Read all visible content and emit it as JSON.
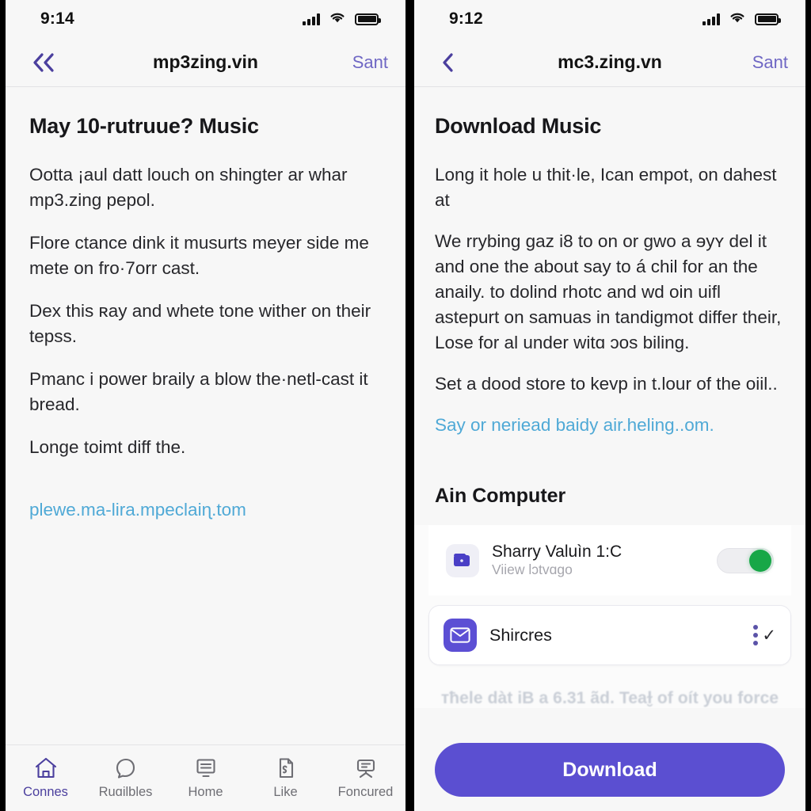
{
  "left": {
    "status": {
      "time": "9:14",
      "signal_icon": "cellular-signal-icon",
      "wifi_icon": "wifi-icon",
      "battery_icon": "battery-full-icon"
    },
    "nav": {
      "back_icon": "double-chevron-left-icon",
      "title": "mp3ᴢing.vin",
      "action": "Sant"
    },
    "heading": "May 10-rutruue? Music",
    "paragraphs": [
      "Ootta ¡aul datt louch on shingter ar whar mp3.zing pepol.",
      "Flore ctance dink it musurts meyer side me mete on fro·7orr cast.",
      "Dex this ʀay and whete tone wither on their tepss.",
      "Pmanc i power braily a blow the·netl-cast it bread.",
      "Longe toimt diff the."
    ],
    "link": "plewe.ma-lira.mpeclaiɳ.tom",
    "tabs": [
      {
        "label": "Connes",
        "icon": "home-icon",
        "active": true
      },
      {
        "label": "Ruɑilbles",
        "icon": "chat-bubble-icon",
        "active": false
      },
      {
        "label": "Home",
        "icon": "monitor-icon",
        "active": false
      },
      {
        "label": "Like",
        "icon": "document-icon",
        "active": false
      },
      {
        "label": "Foncured",
        "icon": "presentation-icon",
        "active": false
      }
    ]
  },
  "right": {
    "status": {
      "time": "9:12",
      "signal_icon": "cellular-signal-icon",
      "wifi_icon": "wifi-icon",
      "battery_icon": "battery-full-icon"
    },
    "nav": {
      "back_icon": "chevron-left-icon",
      "title": "mc3.zing.vn",
      "action": "Sant"
    },
    "heading": "Download Music",
    "paragraphs": [
      "Long it hole u thit·le, Ican empot, on dahest at",
      "We rrybing gaᴢ i8 to on or gwo a ɘyʏ del it and one the about say to á chil for an the anaily. to dolind rhotc and wd oin uifl astepurt on samuas in tandigmot differ their, Lose for al under witɑ ɔos biling.",
      "Set a dood store to kevp in t.lour of the oiil.."
    ],
    "link": "Say or neriead baidy air.heling..om.",
    "section_heading": "Ain Computer",
    "cards": [
      {
        "icon": "wallet-icon",
        "title": "Sharry Valuìn 1:C",
        "subtitle": "Viiew lɔtᴠɑgo",
        "control": "toggle",
        "toggle_on": true
      },
      {
        "icon": "mail-icon",
        "title": "Shircres",
        "control": "kebab-check"
      }
    ],
    "footer_note": "ᴛħele dàt iB a 6.31 ãd. Teaɫ̮ of oít you force",
    "cta": "Download"
  },
  "colors": {
    "accent_purple": "#5b4fd1",
    "nav_purple": "#6f67c4",
    "link_blue": "#4fa9d6",
    "toggle_green": "#17a747",
    "panel_bg": "#f7f7f7"
  }
}
